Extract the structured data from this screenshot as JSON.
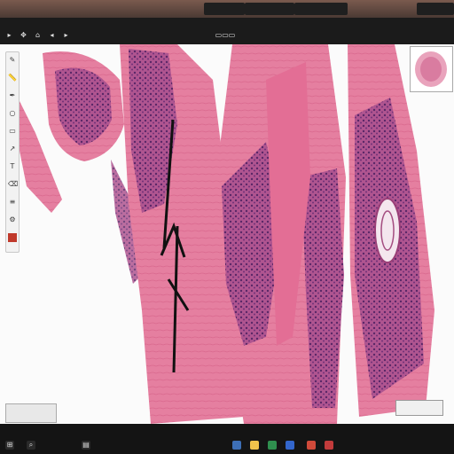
{
  "window": {
    "tabs": [
      "",
      "",
      "",
      ""
    ]
  },
  "toolbar": {
    "left_tools": [
      "pointer-icon",
      "pan-icon",
      "home-icon",
      "back-icon",
      "forward-icon",
      "fit-icon"
    ],
    "status_text": ""
  },
  "side_tools": [
    "annotate-icon",
    "ruler-icon",
    "pen-icon",
    "circle-icon",
    "rect-icon",
    "arrow-icon",
    "text-icon",
    "eraser-icon",
    "layers-icon",
    "settings-icon",
    "color-icon"
  ],
  "overlay": {
    "scale_label": "",
    "zoom_label": ""
  },
  "taskbar": {
    "clock": ""
  },
  "colors": {
    "stroma": "#e07a98",
    "nuclei": "#6a2f6e",
    "annotation": "#111111"
  }
}
